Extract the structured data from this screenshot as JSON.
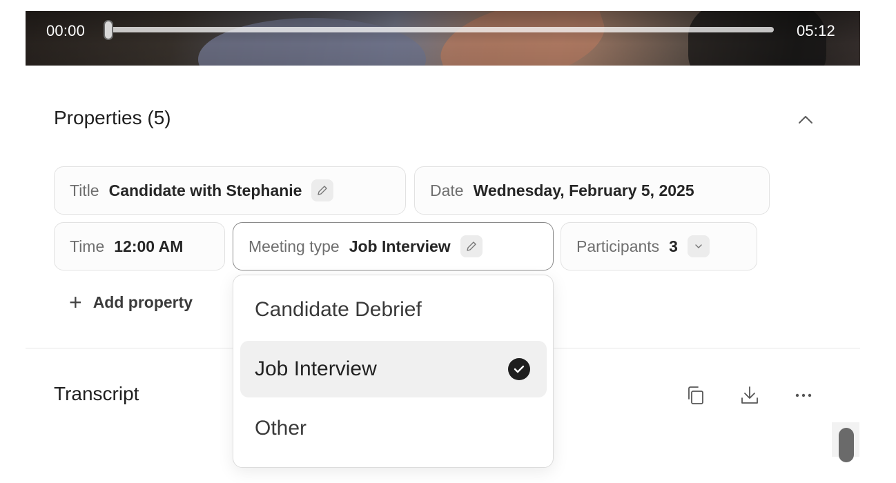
{
  "video": {
    "current_time": "00:00",
    "duration": "05:12",
    "progress": 0
  },
  "properties": {
    "heading": "Properties (5)",
    "items": [
      {
        "key": "Title",
        "value": "Candidate with Stephanie",
        "icon": "pencil-icon"
      },
      {
        "key": "Date",
        "value": "Wednesday, February 5, 2025"
      },
      {
        "key": "Time",
        "value": "12:00 AM"
      },
      {
        "key": "Meeting type",
        "value": "Job Interview",
        "icon": "pencil-icon"
      },
      {
        "key": "Participants",
        "value": "3",
        "icon": "chevron-down-icon"
      }
    ],
    "add_label": "Add property"
  },
  "meeting_type_menu": {
    "options": [
      "Candidate Debrief",
      "Job Interview",
      "Other"
    ],
    "selected": "Job Interview"
  },
  "transcript": {
    "heading": "Transcript",
    "tools": [
      "copy-icon",
      "download-icon",
      "more-icon"
    ]
  }
}
